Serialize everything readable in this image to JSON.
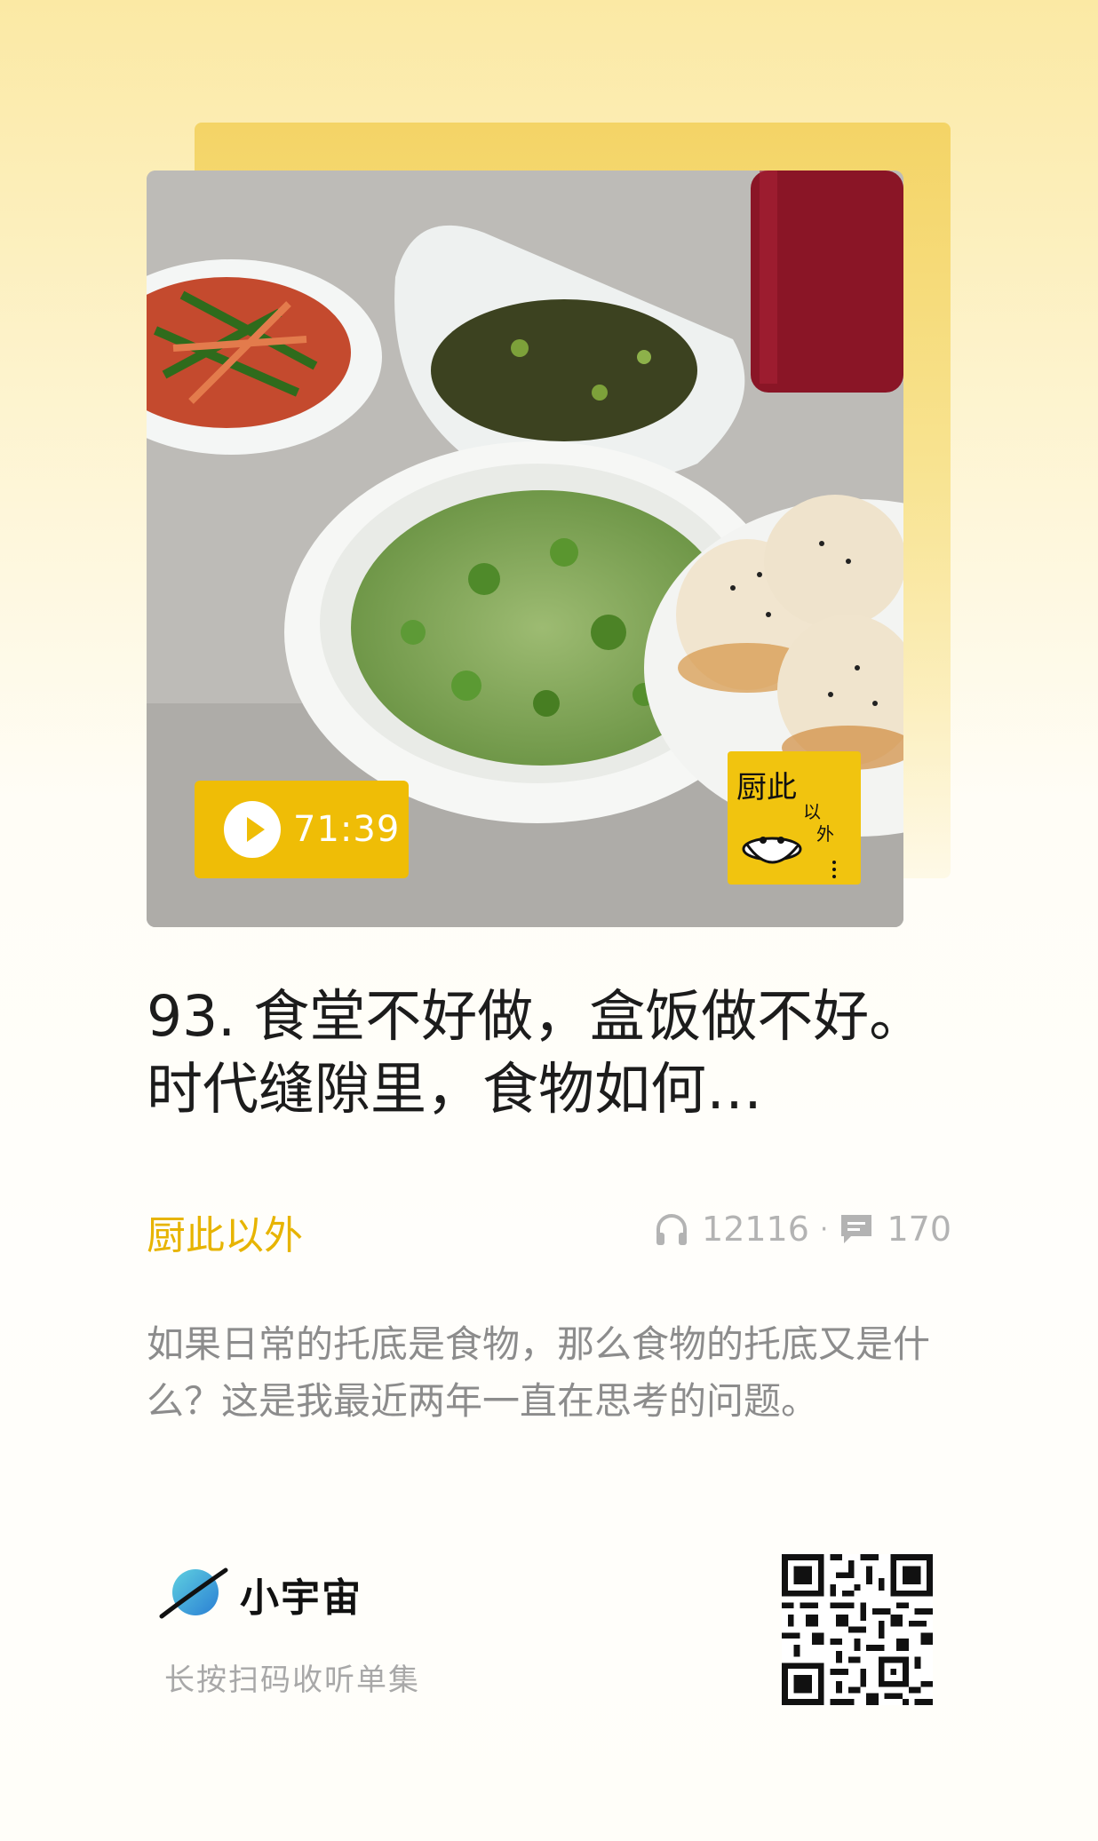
{
  "episode": {
    "duration": "71:39",
    "title": "93. 食堂不好做，盒饭做不好。时代缝隙里，食物如何…",
    "podcast": "厨此以外",
    "plays": "12116",
    "comments": "170",
    "description": "如果日常的托底是食物，那么食物的托底又是什么？这是我最近两年一直在思考的问题。"
  },
  "cover": {
    "logo_text": "厨此以外"
  },
  "footer": {
    "app_name": "小宇宙",
    "scan_hint": "长按扫码收听单集"
  },
  "colors": {
    "accent": "#efbd06",
    "podcast_name": "#e7b400",
    "muted": "#b3b3b3"
  },
  "icons": {
    "plays": "headphones-icon",
    "comments": "comment-icon",
    "play": "play-icon"
  }
}
